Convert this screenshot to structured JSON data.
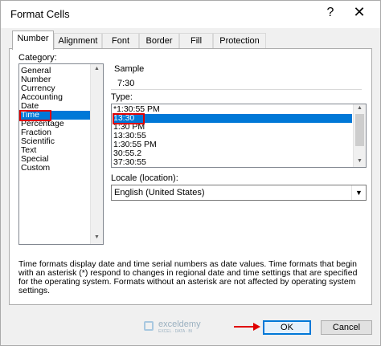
{
  "window": {
    "title": "Format Cells",
    "help_glyph": "?",
    "close_glyph": "✕"
  },
  "tabs": [
    {
      "label": "Number",
      "active": true
    },
    {
      "label": "Alignment"
    },
    {
      "label": "Font"
    },
    {
      "label": "Border"
    },
    {
      "label": "Fill"
    },
    {
      "label": "Protection"
    }
  ],
  "category": {
    "label": "Category:",
    "items": [
      "General",
      "Number",
      "Currency",
      "Accounting",
      "Date",
      "Time",
      "Percentage",
      "Fraction",
      "Scientific",
      "Text",
      "Special",
      "Custom"
    ],
    "selected": "Time"
  },
  "sample": {
    "label": "Sample",
    "value": "7:30"
  },
  "type": {
    "label": "Type:",
    "items": [
      "*1:30:55 PM",
      "13:30",
      "1:30 PM",
      "13:30:55",
      "1:30:55 PM",
      "30:55.2",
      "37:30:55"
    ],
    "selected": "13:30"
  },
  "locale": {
    "label": "Locale (location):",
    "value": "English (United States)"
  },
  "description": "Time formats display date and time serial numbers as date values.  Time formats that begin with an asterisk (*) respond to changes in regional date and time settings that are specified for the operating system. Formats without an asterisk are not affected by operating system settings.",
  "watermark": {
    "name": "exceldemy",
    "tagline": "EXCEL · DATA · BI"
  },
  "buttons": {
    "ok": "OK",
    "cancel": "Cancel"
  },
  "colors": {
    "selection": "#0078d7",
    "highlight": "#e00000"
  }
}
